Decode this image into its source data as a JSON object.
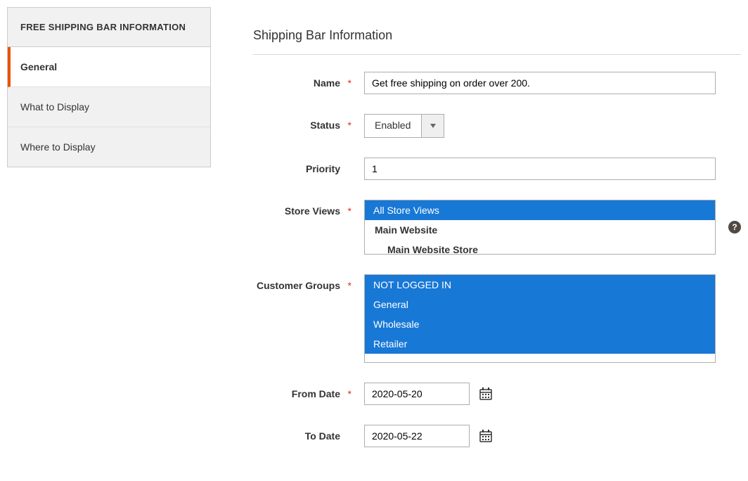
{
  "sidebar": {
    "header": "FREE SHIPPING BAR INFORMATION",
    "items": [
      {
        "label": "General",
        "active": true
      },
      {
        "label": "What to Display",
        "active": false
      },
      {
        "label": "Where to Display",
        "active": false
      }
    ]
  },
  "section": {
    "title": "Shipping Bar Information"
  },
  "form": {
    "name": {
      "label": "Name",
      "value": "Get free shipping on order over 200."
    },
    "status": {
      "label": "Status",
      "value": "Enabled"
    },
    "priority": {
      "label": "Priority",
      "value": "1"
    },
    "storeViews": {
      "label": "Store Views",
      "options": [
        {
          "label": "All Store Views",
          "selected": true,
          "cls": ""
        },
        {
          "label": "Main Website",
          "selected": false,
          "cls": "bold"
        },
        {
          "label": "Main Website Store",
          "selected": false,
          "cls": "indent"
        }
      ]
    },
    "customerGroups": {
      "label": "Customer Groups",
      "options": [
        {
          "label": "NOT LOGGED IN",
          "selected": true
        },
        {
          "label": "General",
          "selected": true
        },
        {
          "label": "Wholesale",
          "selected": true
        },
        {
          "label": "Retailer",
          "selected": true
        }
      ]
    },
    "fromDate": {
      "label": "From Date",
      "value": "2020-05-20"
    },
    "toDate": {
      "label": "To Date",
      "value": "2020-05-22"
    }
  }
}
